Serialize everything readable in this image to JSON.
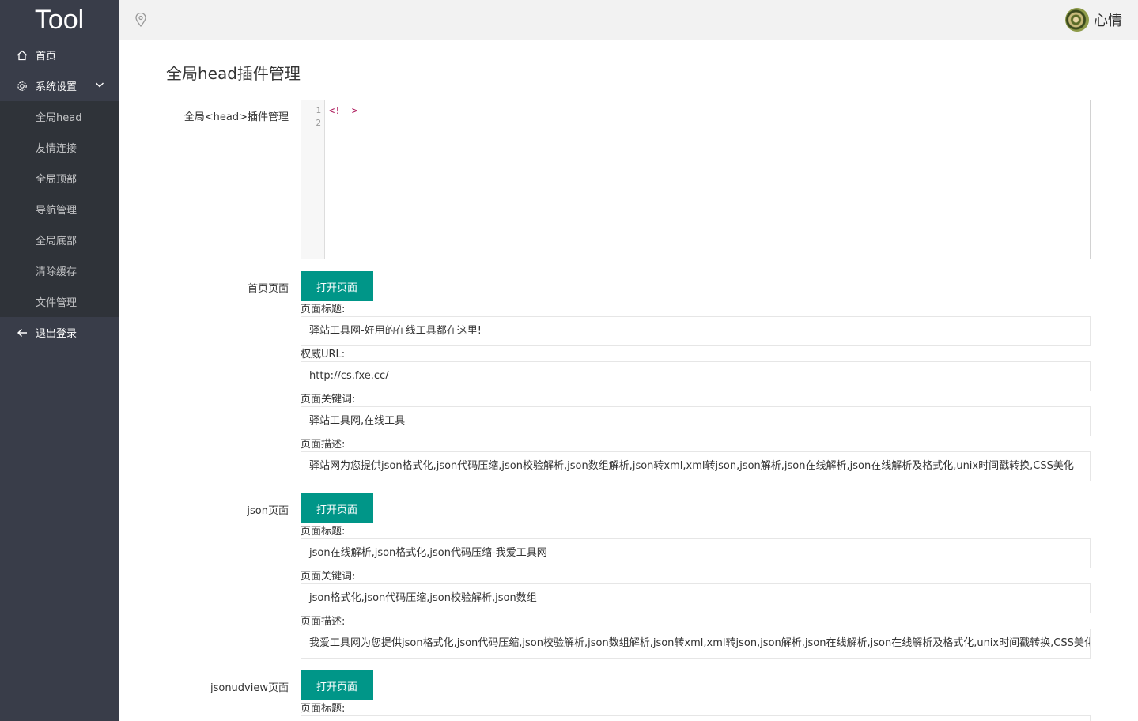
{
  "sidebar": {
    "logo": "Tool",
    "home": "首页",
    "settings": "系统设置",
    "sub_items": [
      "全局head",
      "友情连接",
      "全局顶部",
      "导航管理",
      "全局底部",
      "清除缓存",
      "文件管理"
    ],
    "logout": "退出登录"
  },
  "header": {
    "username": "心情"
  },
  "main": {
    "section_title": "全局head插件管理",
    "editor_label": "全局<head>插件管理",
    "editor_lines": [
      "1",
      "2"
    ],
    "editor_code": "<!——>",
    "open_button": "打开页面",
    "field_labels": {
      "title": "页面标题:",
      "url": "权威URL:",
      "keywords": "页面关键词:",
      "description": "页面描述:"
    },
    "home_page": {
      "label": "首页页面",
      "title": "驿站工具网-好用的在线工具都在这里!",
      "url": "http://cs.fxe.cc/",
      "keywords": "驿站工具网,在线工具",
      "description": "驿站网为您提供json格式化,json代码压缩,json校验解析,json数组解析,json转xml,xml转json,json解析,json在线解析,json在线解析及格式化,unix时间戳转换,CSS美化"
    },
    "json_page": {
      "label": "json页面",
      "title": "json在线解析,json格式化,json代码压缩-我爱工具网",
      "keywords": "json格式化,json代码压缩,json校验解析,json数组",
      "description": "我爱工具网为您提供json格式化,json代码压缩,json校验解析,json数组解析,json转xml,xml转json,json解析,json在线解析,json在线解析及格式化,unix时间戳转换,CSS美化"
    },
    "jsonud_page": {
      "label": "jsonudview页面"
    }
  }
}
